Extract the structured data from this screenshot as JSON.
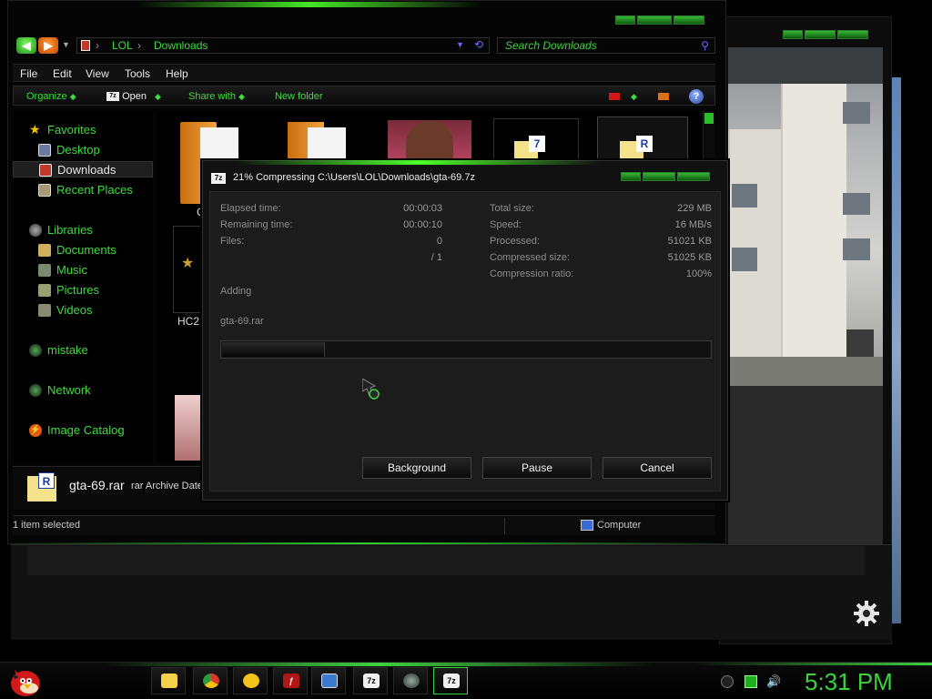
{
  "explorer": {
    "address": {
      "root": "LOL",
      "folder": "Downloads"
    },
    "search_placeholder": "Search Downloads",
    "menu": [
      "File",
      "Edit",
      "View",
      "Tools",
      "Help"
    ],
    "toolbar": {
      "organize": "Organize",
      "open": "Open",
      "share": "Share with",
      "new_folder": "New folder"
    },
    "nav": {
      "favorites": "Favorites",
      "desktop": "Desktop",
      "downloads": "Downloads",
      "recent": "Recent Places",
      "libraries": "Libraries",
      "documents": "Documents",
      "music": "Music",
      "pictures": "Pictures",
      "videos": "Videos",
      "mistake": "mistake",
      "network": "Network",
      "image_catalog": "Image Catalog"
    },
    "files_partial": {
      "file_a": "C",
      "file_b": "HC2"
    },
    "details": {
      "name": "gta-69.rar",
      "type": "rar Archive Date"
    },
    "status": {
      "selected": "1 item selected",
      "location": "Computer"
    }
  },
  "dialog": {
    "title": "21% Compressing C:\\Users\\LOL\\Downloads\\gta-69.7z",
    "app_icon": "7z",
    "left": [
      {
        "label": "Elapsed time:",
        "value": "00:00:03"
      },
      {
        "label": "Remaining time:",
        "value": "00:00:10"
      },
      {
        "label": "Files:",
        "value": "0"
      },
      {
        "label": "",
        "value": "/ 1"
      }
    ],
    "right": [
      {
        "label": "Total size:",
        "value": "229 MB"
      },
      {
        "label": "Speed:",
        "value": "16 MB/s"
      },
      {
        "label": "Processed:",
        "value": "51021 KB"
      },
      {
        "label": "Compressed size:",
        "value": "51025 KB"
      },
      {
        "label": "Compression ratio:",
        "value": "100%"
      }
    ],
    "status": "Adding",
    "current_file": "gta-69.rar",
    "progress_fraction": 0.21,
    "buttons": {
      "background": "Background",
      "pause": "Pause",
      "cancel": "Cancel"
    }
  },
  "taskbar": {
    "clock": "5:31 PM",
    "buttons": [
      {
        "icon": "folder-icon",
        "label": ""
      },
      {
        "icon": "chrome-icon",
        "label": ""
      },
      {
        "icon": "messenger-icon",
        "label": ""
      },
      {
        "icon": "flash-icon",
        "label": ""
      },
      {
        "icon": "picture-viewer-icon",
        "label": ""
      },
      {
        "icon": "7zip-icon",
        "label": "7z"
      },
      {
        "icon": "network-globe-icon",
        "label": ""
      },
      {
        "icon": "7zip-active-icon",
        "label": "7z"
      }
    ]
  },
  "colors": {
    "accent_green": "#3edc3e",
    "background": "#000000"
  }
}
